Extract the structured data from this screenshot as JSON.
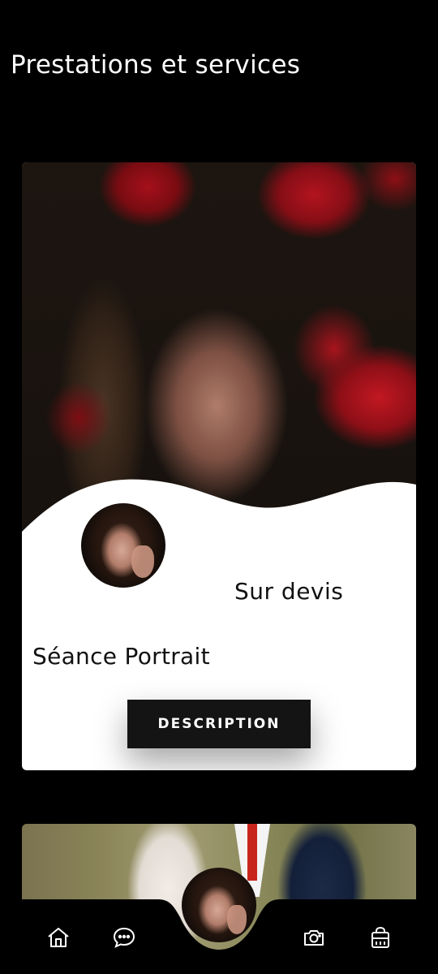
{
  "header": {
    "title": "Prestations et services"
  },
  "services": [
    {
      "name": "Séance Portrait",
      "price": "Sur devis",
      "button_label": "DESCRIPTION"
    }
  ],
  "nav": {
    "items": [
      {
        "icon": "home-icon"
      },
      {
        "icon": "chat-icon"
      },
      {
        "icon": "profile-avatar"
      },
      {
        "icon": "camera-icon"
      },
      {
        "icon": "shop-icon"
      }
    ]
  },
  "colors": {
    "background": "#000000",
    "card": "#ffffff",
    "button": "#141414"
  }
}
